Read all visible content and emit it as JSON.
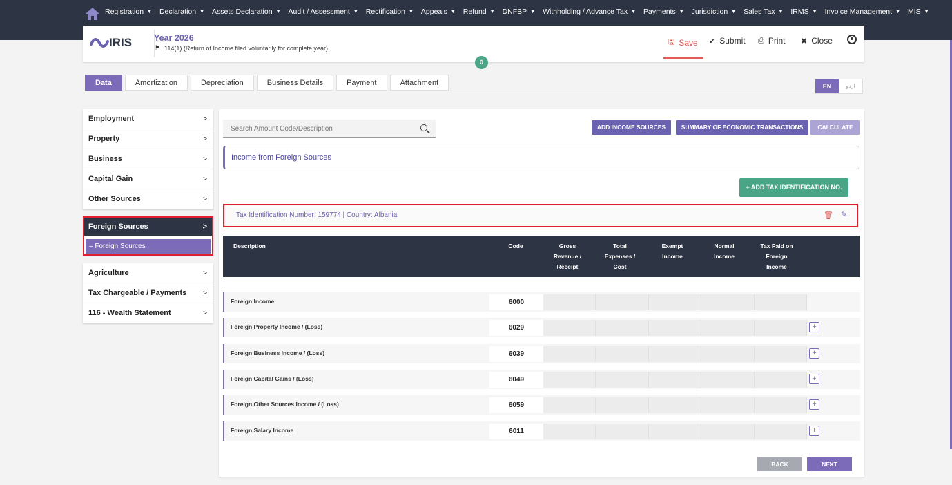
{
  "topnav": {
    "items": [
      "Registration",
      "Declaration",
      "Assets Declaration",
      "Audit / Assessment",
      "Rectification",
      "Appeals",
      "Refund",
      "DNFBP",
      "Withholding / Advance Tax",
      "Payments",
      "Jurisdiction",
      "Sales Tax",
      "IRMS",
      "Invoice Management",
      "MIS"
    ]
  },
  "header": {
    "logo": "IRIS",
    "year": "Year 2026",
    "return_type": "114(1) (Return of Income filed voluntarily for complete year)",
    "save": "Save",
    "submit": "Submit",
    "print": "Print",
    "close": "Close"
  },
  "tabs": [
    "Data",
    "Amortization",
    "Depreciation",
    "Business Details",
    "Payment",
    "Attachment"
  ],
  "lang": {
    "en": "EN",
    "ur": "اردو"
  },
  "sidebar": {
    "top": [
      "Employment",
      "Property",
      "Business",
      "Capital Gain",
      "Other Sources"
    ],
    "active": "Foreign Sources",
    "active_sub": "– Foreign Sources",
    "bottom": [
      "Agriculture",
      "Tax Chargeable / Payments",
      "116 - Wealth Statement"
    ]
  },
  "main": {
    "search_placeholder": "Search Amount Code/Description",
    "btn_add_sources": "ADD INCOME SOURCES",
    "btn_summary": "SUMMARY OF ECONOMIC TRANSACTIONS",
    "btn_calculate": "CALCULATE",
    "section_title": "Income from Foreign Sources",
    "btn_add_tin": "+ ADD TAX IDENTIFICATION NO.",
    "tin_label": "Tax Identification Number: 159774 | Country: Albania",
    "columns": {
      "description": "Description",
      "code": "Code",
      "gross": "Gross Revenue / Receipt",
      "expenses": "Total Expenses / Cost",
      "exempt": "Exempt Income",
      "normal": "Normal Income",
      "taxpaid": "Tax Paid on Foreign Income"
    },
    "rows": [
      {
        "label": "Foreign Income",
        "code": "6000"
      },
      {
        "label": "Foreign Property Income / (Loss)",
        "code": "6029"
      },
      {
        "label": "Foreign Business Income / (Loss)",
        "code": "6039"
      },
      {
        "label": "Foreign Capital Gains / (Loss)",
        "code": "6049"
      },
      {
        "label": "Foreign Other Sources Income / (Loss)",
        "code": "6059"
      },
      {
        "label": "Foreign Salary Income",
        "code": "6011"
      }
    ],
    "back": "BACK",
    "next": "NEXT"
  }
}
